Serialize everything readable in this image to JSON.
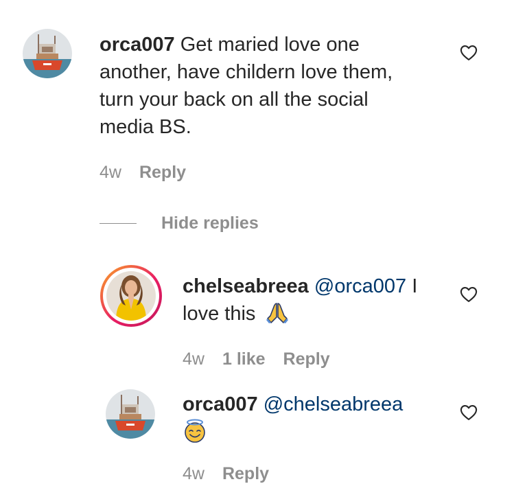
{
  "comments": [
    {
      "username": "orca007",
      "text": "Get maried love one another, have childern love them, turn your back on all the social media BS.",
      "time": "4w",
      "reply_label": "Reply"
    }
  ],
  "hide_replies_label": "Hide replies",
  "replies": [
    {
      "username": "chelseabreea",
      "mention": "@orca007",
      "text_tail": "I love this",
      "emoji": "folded-hands",
      "time": "4w",
      "likes": "1 like",
      "reply_label": "Reply"
    },
    {
      "username": "orca007",
      "mention": "@chelseabreea",
      "emoji": "smiling-face-with-halo",
      "time": "4w",
      "reply_label": "Reply"
    }
  ],
  "colors": {
    "text": "#262626",
    "muted": "#8e8e8e",
    "mention": "#00376b",
    "story_ring_start": "#f9a825",
    "story_ring_end": "#c2185b"
  }
}
